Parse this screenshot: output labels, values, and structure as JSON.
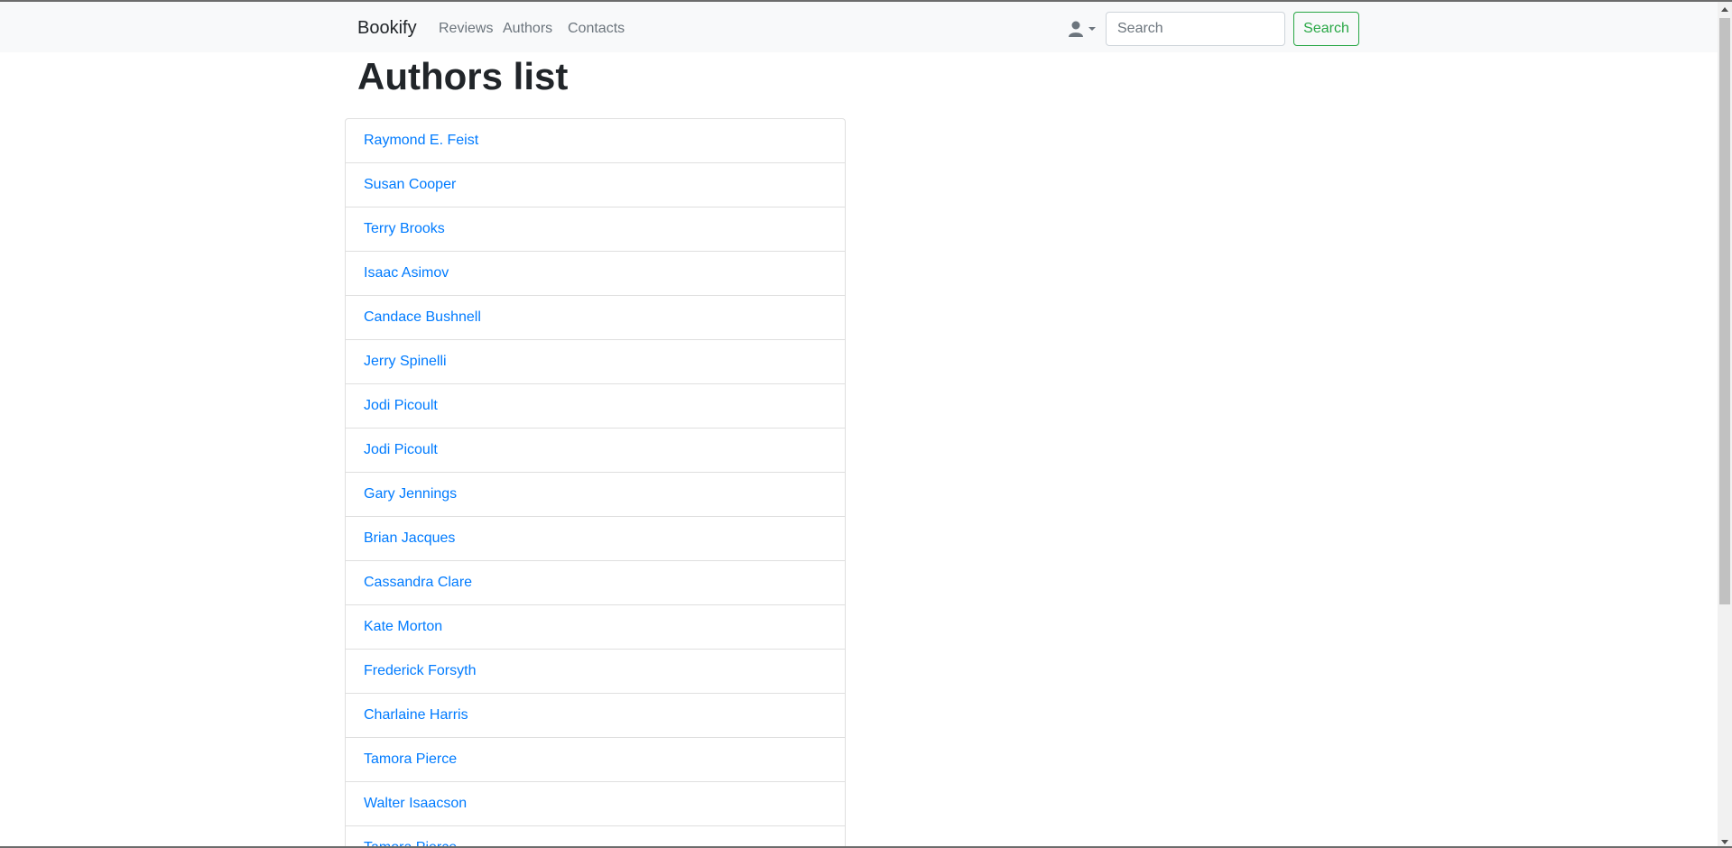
{
  "navbar": {
    "brand": "Bookify",
    "links": [
      {
        "label": "Reviews"
      },
      {
        "label": "Authors"
      },
      {
        "label": "Contacts"
      }
    ],
    "user_icon": "user-icon",
    "search": {
      "placeholder": "Search",
      "value": "",
      "button_label": "Search"
    }
  },
  "page": {
    "title": "Authors list"
  },
  "authors": [
    "Raymond E. Feist",
    "Susan Cooper",
    "Terry Brooks",
    "Isaac Asimov",
    "Candace Bushnell",
    "Jerry Spinelli",
    "Jodi Picoult",
    "Jodi Picoult",
    "Gary Jennings",
    "Brian Jacques",
    "Cassandra Clare",
    "Kate Morton",
    "Frederick Forsyth",
    "Charlaine Harris",
    "Tamora Pierce",
    "Walter Isaacson",
    "Tamora Pierce"
  ],
  "colors": {
    "link": "#007bff",
    "navbar_bg": "#f8f9fa",
    "success": "#28a745",
    "nav_muted": "#6c757d"
  }
}
